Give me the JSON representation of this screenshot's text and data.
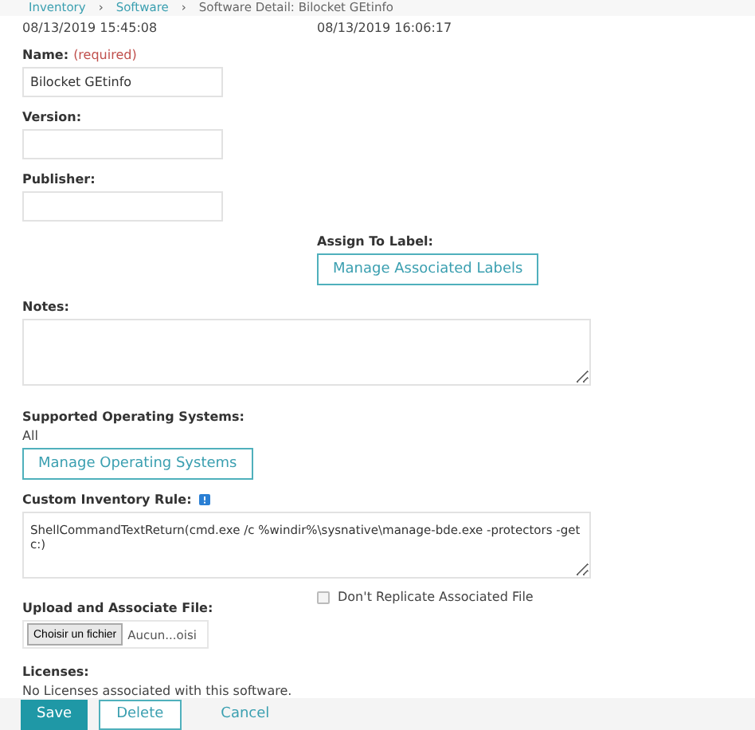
{
  "breadcrumb": {
    "items": [
      {
        "label": "Inventory",
        "kind": "link"
      },
      {
        "label": "Software",
        "kind": "link"
      },
      {
        "label": "Software Detail: Bilocket GEtinfo",
        "kind": "current"
      }
    ],
    "separator": "›"
  },
  "dates": [
    "08/13/2019 15:45:08",
    "08/13/2019 16:06:17"
  ],
  "name": {
    "label": "Name:",
    "required": "(required)",
    "value": "Bilocket GEtinfo"
  },
  "version": {
    "label": "Version:"
  },
  "publisher": {
    "label": "Publisher:"
  },
  "assign_label": {
    "label": "Assign To Label:",
    "button": "Manage Associated Labels"
  },
  "notes": {
    "label": "Notes:"
  },
  "supported_os": {
    "label": "Supported Operating Systems:",
    "value": "All",
    "button": "Manage Operating Systems"
  },
  "custom_rule": {
    "label": "Custom Inventory Rule:",
    "value": "ShellCommandTextReturn(cmd.exe /c %windir%\\sysnative\\manage-bde.exe -protectors -get c:)"
  },
  "upload": {
    "label": "Upload and Associate File:",
    "choose_button": "Choisir un fichier",
    "file_text": "Aucun...oisi",
    "dont_replicate": {
      "label": "Don't Replicate Associated File",
      "checked": false
    }
  },
  "licenses": {
    "label": "Licenses:",
    "text": "No Licenses associated with this software."
  },
  "footer": {
    "buttons": [
      {
        "label": "Save",
        "kind": "primary"
      },
      {
        "label": "Delete",
        "kind": "outline"
      },
      {
        "label": "Cancel",
        "kind": "link"
      }
    ]
  }
}
